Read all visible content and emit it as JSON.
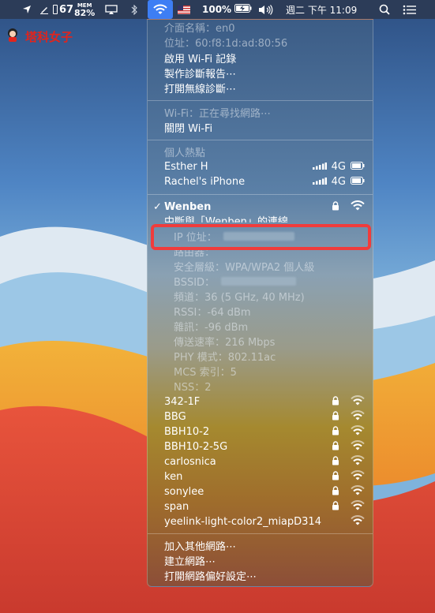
{
  "menubar": {
    "battery_percent_left": "67",
    "mem_label_top": "MEM",
    "mem_label_bottom": "82%",
    "battery_percent": "100%",
    "datetime": "週二 下午 11:09"
  },
  "watermark": {
    "text": "塔科女子"
  },
  "menu": {
    "interface_name": "介面名稱：en0",
    "address": "位址：60:f8:1d:ad:80:56",
    "enable_logging": "啟用 Wi-Fi 記錄",
    "create_diagnostics": "製作診斷報告⋯",
    "open_wireless_diagnostics": "打開無線診斷⋯",
    "wifi_status": "Wi-Fi：正在尋找網路⋯",
    "turn_off_wifi": "關閉 Wi-Fi",
    "hotspot_header": "個人熱點",
    "hotspots": [
      {
        "name": "Esther H",
        "signal": "4G"
      },
      {
        "name": "Rachel's iPhone",
        "signal": "4G"
      }
    ],
    "connected_network": "Wenben",
    "disconnect": "中斷與「Wenben」的連線",
    "ip_address": "IP 位址：",
    "router": "路由器：",
    "security": "安全層級：WPA/WPA2 個人級",
    "bssid": "BSSID：",
    "channel": "頻道：36 (5 GHz, 40 MHz)",
    "rssi": "RSSI：-64 dBm",
    "noise": "雜訊：-96 dBm",
    "tx_rate": "傳送速率：216 Mbps",
    "phy_mode": "PHY 模式：802.11ac",
    "mcs_index": "MCS 索引：5",
    "nss": "NSS：2",
    "networks": [
      {
        "name": "342-1F",
        "locked": true
      },
      {
        "name": "BBG",
        "locked": true
      },
      {
        "name": "BBH10-2",
        "locked": true
      },
      {
        "name": "BBH10-2-5G",
        "locked": true
      },
      {
        "name": "carlosnica",
        "locked": true
      },
      {
        "name": "ken",
        "locked": true
      },
      {
        "name": "sonylee",
        "locked": true
      },
      {
        "name": "span",
        "locked": true
      },
      {
        "name": "yeelink-light-color2_miapD314",
        "locked": false
      }
    ],
    "join_other": "加入其他網路⋯",
    "create_network": "建立網路⋯",
    "open_preferences": "打開網路偏好設定⋯"
  },
  "colors": {
    "highlight": "#f03c3c",
    "menubar_active": "#3d7ef4"
  }
}
